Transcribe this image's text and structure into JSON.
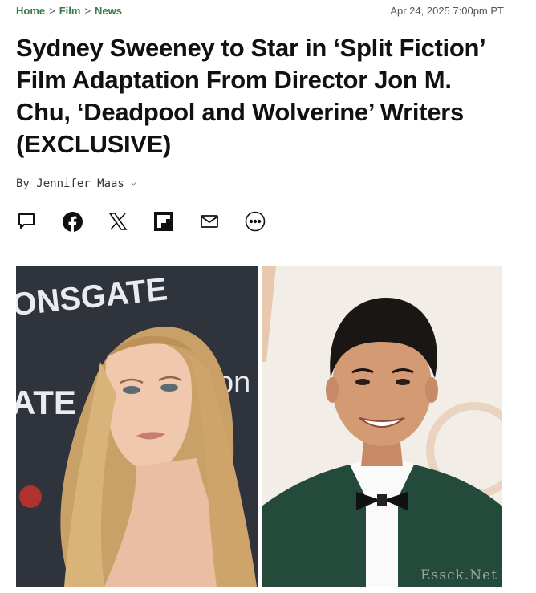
{
  "breadcrumb": {
    "items": [
      "Home",
      "Film",
      "News"
    ],
    "separator": ">"
  },
  "date": "Apr 24, 2025 7:00pm PT",
  "headline": "Sydney Sweeney to Star in ‘Split Fiction’ Film Adaptation From Director Jon M. Chu, ‘Deadpool and Wolverine’ Writers (EXCLUSIVE)",
  "byline": {
    "text": "By Jennifer Maas",
    "chevron": "⌄"
  },
  "share_icons": [
    "comment-icon",
    "facebook-icon",
    "x-icon",
    "flipboard-icon",
    "email-icon",
    "more-icon"
  ],
  "photo": {
    "left_backdrop_text": [
      "ONSGATE",
      "ATE",
      "on"
    ],
    "left_subject": "woman with long wavy blonde hair",
    "right_subject": "man in green velvet tuxedo with black bow tie"
  },
  "watermark": "Essck.Net",
  "colors": {
    "breadcrumb": "#3a7a4a",
    "headline": "#111111",
    "backdrop_left": "#2f343c",
    "backdrop_right": "#f2ede6",
    "jacket": "#234a3b"
  }
}
